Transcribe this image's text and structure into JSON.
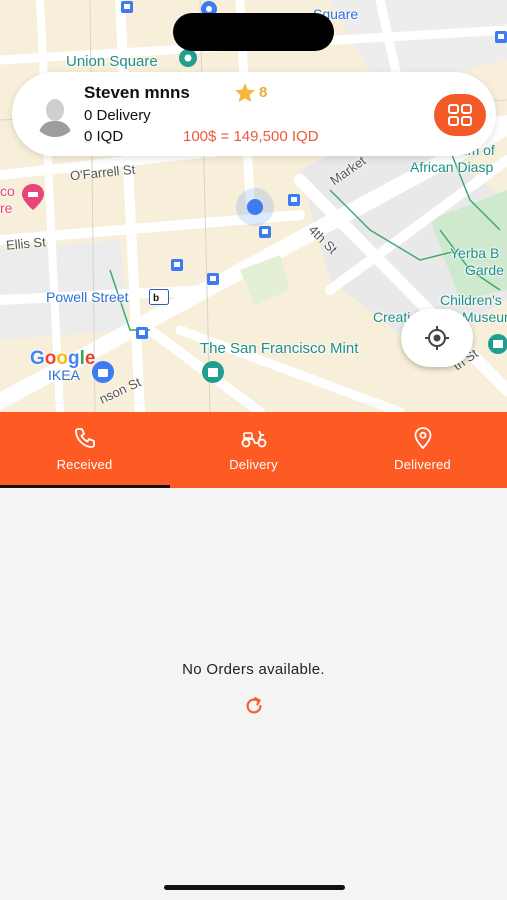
{
  "map": {
    "labels": {
      "union_square": "Union Square",
      "square_top": "Square",
      "ofarrell": "O'Farrell St",
      "ellis": "Ellis St",
      "powell": "Powell Street",
      "fourth": "4th St",
      "market": "Market",
      "african": "African Diasp",
      "museum_of": "eum of",
      "yerba1": "Yerba B",
      "yerba2": "Garde",
      "childrens": "Children's",
      "creativity": "Creati",
      "museum2": "Museum",
      "mint": "The San Francisco Mint",
      "ikea": "IKEA",
      "jessie": "nson St",
      "hotel_co": "co",
      "hotel_re": "re",
      "th_st": "th St"
    },
    "google": [
      "G",
      "o",
      "o",
      "g",
      "l",
      "e"
    ]
  },
  "profile": {
    "name": "Steven mnns",
    "rating": "8",
    "deliveries": "0 Delivery",
    "balance": "0 IQD",
    "exchange_rate": "100$ = 149,500 IQD"
  },
  "tabs": [
    {
      "label": "Received",
      "icon": "phone-icon"
    },
    {
      "label": "Delivery",
      "icon": "scooter-icon"
    },
    {
      "label": "Delivered",
      "icon": "location-pin-icon"
    }
  ],
  "active_tab": 0,
  "empty_state": {
    "message": "No Orders available.",
    "refresh_icon": "refresh-icon"
  },
  "colors": {
    "accent": "#fe5a24",
    "rate_text": "#ec5a3e",
    "star": "#f2a93b"
  }
}
